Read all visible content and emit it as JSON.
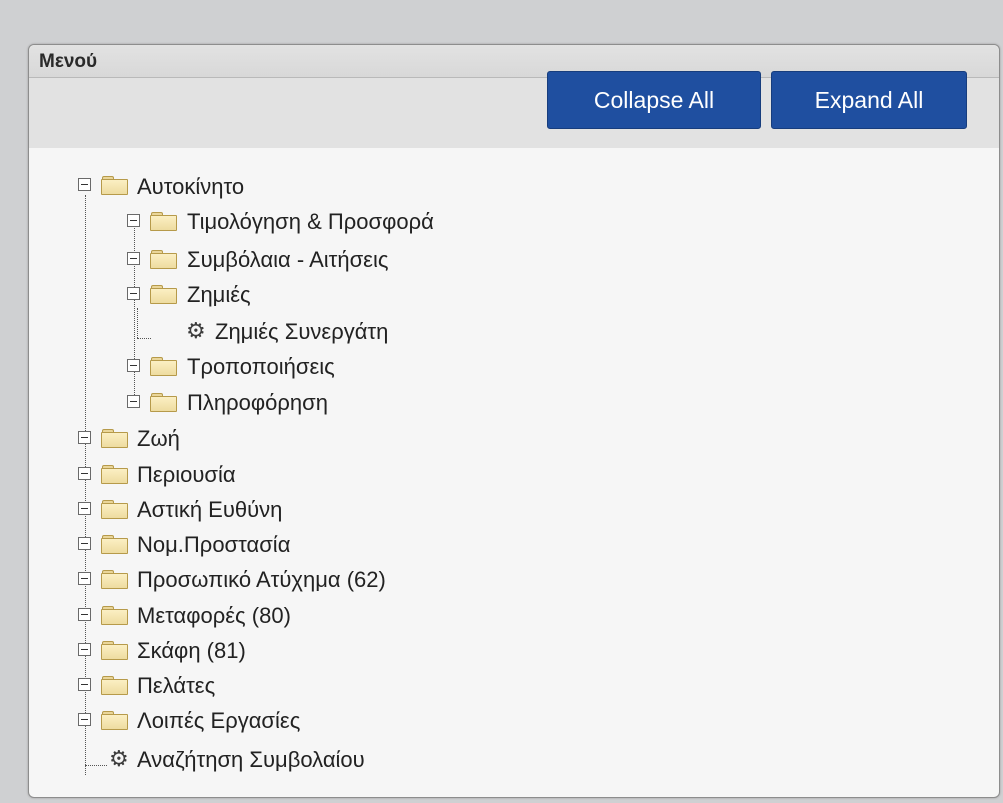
{
  "panel": {
    "title": "Μενού",
    "collapse_all": "Collapse All",
    "expand_all": "Expand All"
  },
  "tree": {
    "root": {
      "label": "Αυτοκίνητο",
      "state": "expanded",
      "children": [
        {
          "label": "Τιμολόγηση & Προσφορά",
          "state": "collapsed"
        },
        {
          "label": "Συμβόλαια - Αιτήσεις",
          "state": "collapsed"
        },
        {
          "label": "Ζημιές",
          "state": "expanded",
          "children": [
            {
              "label": "Ζημιές Συνεργάτη",
              "icon": "gear-icon"
            }
          ]
        },
        {
          "label": "Τροποποιήσεις",
          "state": "collapsed"
        },
        {
          "label": "Πληροφόρηση",
          "state": "collapsed"
        }
      ]
    },
    "top_level": [
      {
        "label": "Ζωή",
        "state": "collapsed"
      },
      {
        "label": "Περιουσία",
        "state": "collapsed"
      },
      {
        "label": "Αστική Ευθύνη",
        "state": "collapsed"
      },
      {
        "label": "Νομ.Προστασία",
        "state": "collapsed"
      },
      {
        "label": "Προσωπικό Ατύχημα (62)",
        "state": "collapsed"
      },
      {
        "label": "Μεταφορές (80)",
        "state": "collapsed"
      },
      {
        "label": "Σκάφη (81)",
        "state": "collapsed"
      },
      {
        "label": "Πελάτες",
        "state": "collapsed"
      },
      {
        "label": "Λοιπές Εργασίες",
        "state": "collapsed"
      }
    ],
    "search": {
      "label": "Αναζήτηση Συμβολαίου",
      "icon": "gear-icon"
    }
  }
}
